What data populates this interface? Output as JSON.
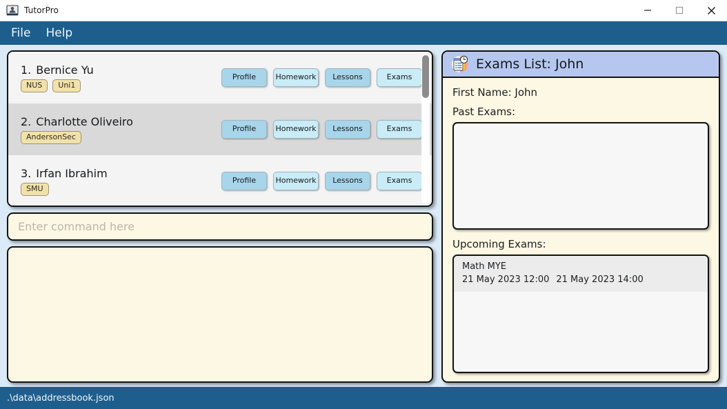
{
  "window": {
    "title": "TutorPro",
    "icon": "app-tutor-icon",
    "controls": {
      "minimize": "minimize-icon",
      "maximize": "maximize-icon",
      "close": "close-icon"
    }
  },
  "menubar": {
    "items": [
      {
        "label": "File"
      },
      {
        "label": "Help"
      }
    ]
  },
  "student_list": {
    "students": [
      {
        "index": "1.",
        "name": "Bernice Yu",
        "tags": [
          "NUS",
          "Uni1"
        ],
        "buttons": [
          "Profile",
          "Homework",
          "Lessons",
          "Exams"
        ]
      },
      {
        "index": "2.",
        "name": "Charlotte Oliveiro",
        "tags": [
          "AndersonSec"
        ],
        "buttons": [
          "Profile",
          "Homework",
          "Lessons",
          "Exams"
        ]
      },
      {
        "index": "3.",
        "name": "Irfan Ibrahim",
        "tags": [
          "SMU"
        ],
        "buttons": [
          "Profile",
          "Homework",
          "Lessons",
          "Exams"
        ]
      }
    ]
  },
  "command_box": {
    "value": "",
    "placeholder": "Enter command here"
  },
  "result_box": {
    "value": ""
  },
  "exams_panel": {
    "header_icon": "exam-schedule-icon",
    "header_title": "Exams List: John",
    "first_name_line": "First Name: John",
    "past_exams_label": "Past Exams:",
    "past_exams": [],
    "upcoming_exams_label": "Upcoming Exams:",
    "upcoming_exams": [
      {
        "name": "Math MYE",
        "start": "21 May 2023 12:00",
        "end": "21 May 2023 14:00"
      }
    ]
  },
  "statusbar": {
    "path": ".\\data\\addressbook.json"
  },
  "colors": {
    "chrome_blue": "#1d5e8c",
    "app_background": "#dbeaf7",
    "panel_cream": "#fdf8e3",
    "header_lavender": "#b6c7ef",
    "tag_beige": "#f1e2ab",
    "button_blue_dark": "#a8d5ea",
    "button_blue_light": "#c9ecf7"
  }
}
